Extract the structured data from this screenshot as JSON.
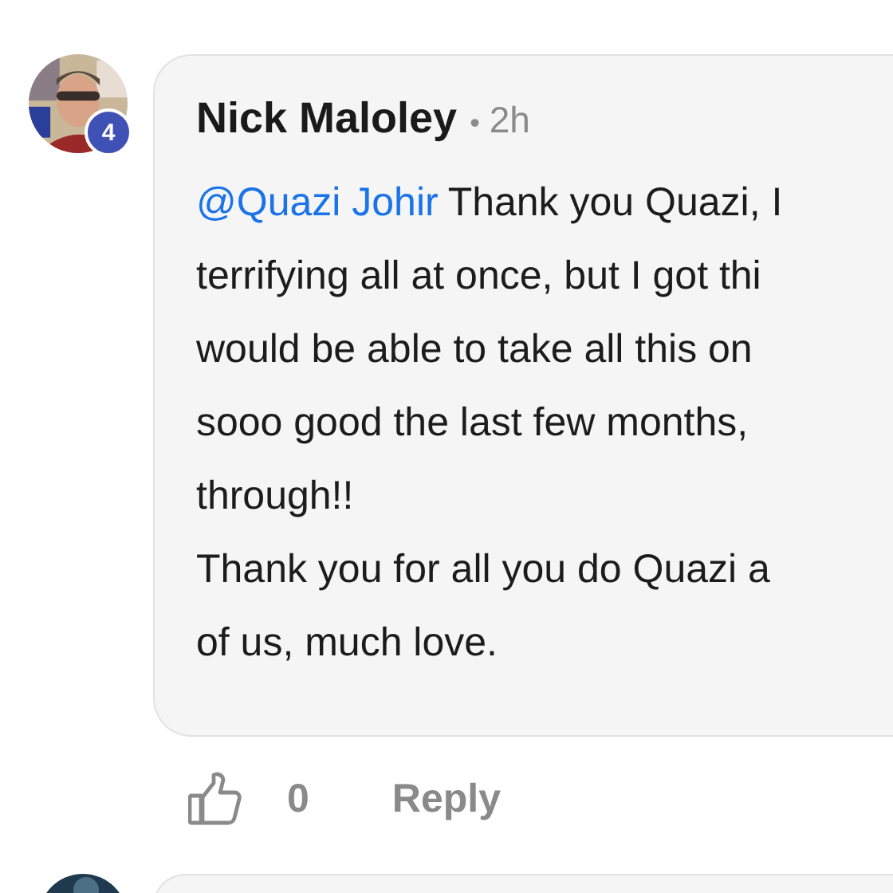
{
  "comment": {
    "author": "Nick Maloley",
    "separator": "•",
    "age": "2h",
    "badge": "4",
    "lines": [
      {
        "mention": "@Quazi Johir",
        "text": "Thank you Quazi, I"
      },
      {
        "text": "terrifying all at once, but I got thi"
      },
      {
        "text": "would be able to take all this on"
      },
      {
        "text": "sooo good the last few months,"
      },
      {
        "text": "through!!"
      },
      {
        "text": "Thank you for all you do Quazi a"
      },
      {
        "text": "of us, much love."
      }
    ],
    "likes": "0",
    "reply": "Reply"
  }
}
